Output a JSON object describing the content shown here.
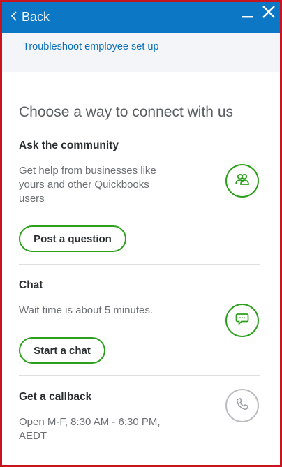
{
  "header": {
    "back_label": "Back",
    "icons": {
      "back": "chevron-left-icon",
      "minimize": "minimize-icon",
      "close": "close-icon"
    },
    "color": "#0b77c5"
  },
  "top_link": {
    "label": "Troubleshoot employee set up"
  },
  "main": {
    "heading": "Choose a way to connect with us",
    "community": {
      "title": "Ask the community",
      "description_lines": [
        "Get help from businesses like",
        "yours and other Quickbooks",
        "users"
      ],
      "button_label": "Post a question",
      "icon": "people-icon"
    },
    "chat": {
      "title": "Chat",
      "description": "Wait time is about 5 minutes.",
      "button_label": "Start a chat",
      "icon": "chat-bubble-icon"
    },
    "callback": {
      "title": "Get a callback",
      "description_lines": [
        "Open M-F, 8:30 AM - 6:30 PM,",
        "AEDT"
      ],
      "icon": "phone-icon"
    }
  },
  "colors": {
    "accent_green": "#2ca01c",
    "link_blue": "#0a6fb8",
    "border_red": "#c8141e"
  }
}
